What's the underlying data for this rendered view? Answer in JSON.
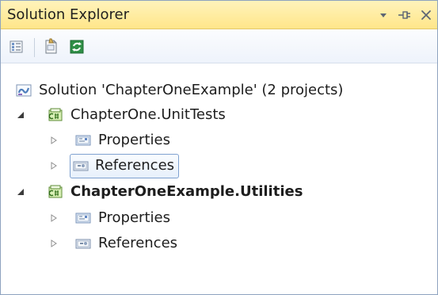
{
  "window": {
    "title": "Solution Explorer",
    "controls": {
      "dropdown_icon": "dropdown-arrow-icon",
      "pin_icon": "pin-icon",
      "close_icon": "close-icon"
    }
  },
  "toolbar": {
    "buttons": [
      {
        "icon": "show-all-files-icon"
      },
      {
        "icon": "properties-icon"
      },
      {
        "icon": "refresh-icon"
      }
    ]
  },
  "tree": {
    "solution": {
      "label": "Solution 'ChapterOneExample' (2 projects)",
      "icon": "solution-icon"
    },
    "projects": [
      {
        "label": "ChapterOne.UnitTests",
        "icon": "csharp-project-icon",
        "expanded": true,
        "children": [
          {
            "label": "Properties",
            "icon": "properties-folder-icon",
            "selected": false
          },
          {
            "label": "References",
            "icon": "references-folder-icon",
            "selected": true
          }
        ]
      },
      {
        "label": "ChapterOneExample.Utilities",
        "icon": "csharp-project-icon",
        "expanded": true,
        "bold": true,
        "children": [
          {
            "label": "Properties",
            "icon": "properties-folder-icon",
            "selected": false
          },
          {
            "label": "References",
            "icon": "references-folder-icon",
            "selected": false
          }
        ]
      }
    ]
  },
  "colors": {
    "titlebar": "#ffe68a",
    "border": "#8ea3bf",
    "selection_border": "#7fa1d0",
    "selection_fill": "#e7f0fb"
  }
}
